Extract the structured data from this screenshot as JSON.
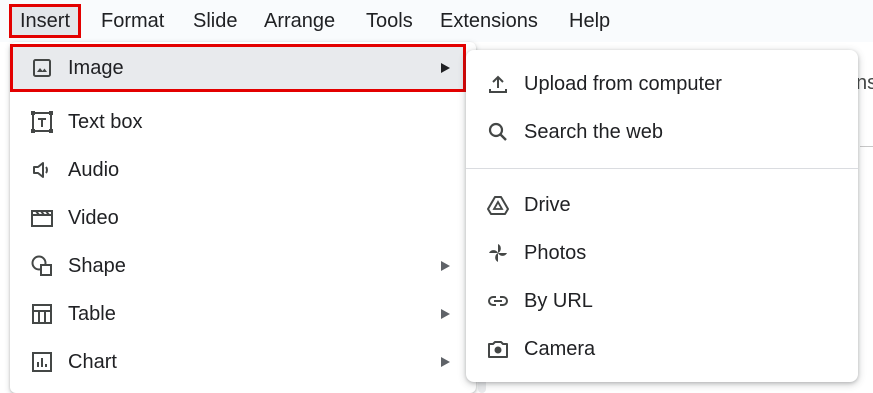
{
  "menubar": {
    "items": [
      "Insert",
      "Format",
      "Slide",
      "Arrange",
      "Tools",
      "Extensions",
      "Help"
    ],
    "active": "Insert"
  },
  "background": {
    "partial_text": "ns"
  },
  "insert_menu": {
    "items": [
      {
        "label": "Image",
        "icon": "image-icon",
        "has_submenu": true,
        "highlighted": true
      },
      {
        "label": "Text box",
        "icon": "text-box-icon",
        "has_submenu": false
      },
      {
        "label": "Audio",
        "icon": "audio-icon",
        "has_submenu": false
      },
      {
        "label": "Video",
        "icon": "video-icon",
        "has_submenu": false
      },
      {
        "label": "Shape",
        "icon": "shape-icon",
        "has_submenu": true
      },
      {
        "label": "Table",
        "icon": "table-icon",
        "has_submenu": true
      },
      {
        "label": "Chart",
        "icon": "chart-icon",
        "has_submenu": true
      }
    ]
  },
  "image_submenu": {
    "items": [
      {
        "label": "Upload from computer",
        "icon": "upload-icon"
      },
      {
        "label": "Search the web",
        "icon": "search-icon"
      },
      {
        "label": "Drive",
        "icon": "drive-icon"
      },
      {
        "label": "Photos",
        "icon": "photos-icon"
      },
      {
        "label": "By URL",
        "icon": "link-icon"
      },
      {
        "label": "Camera",
        "icon": "camera-icon"
      }
    ]
  },
  "colors": {
    "highlight_border": "#e30000",
    "menu_bg": "#ffffff",
    "text": "#202124"
  }
}
